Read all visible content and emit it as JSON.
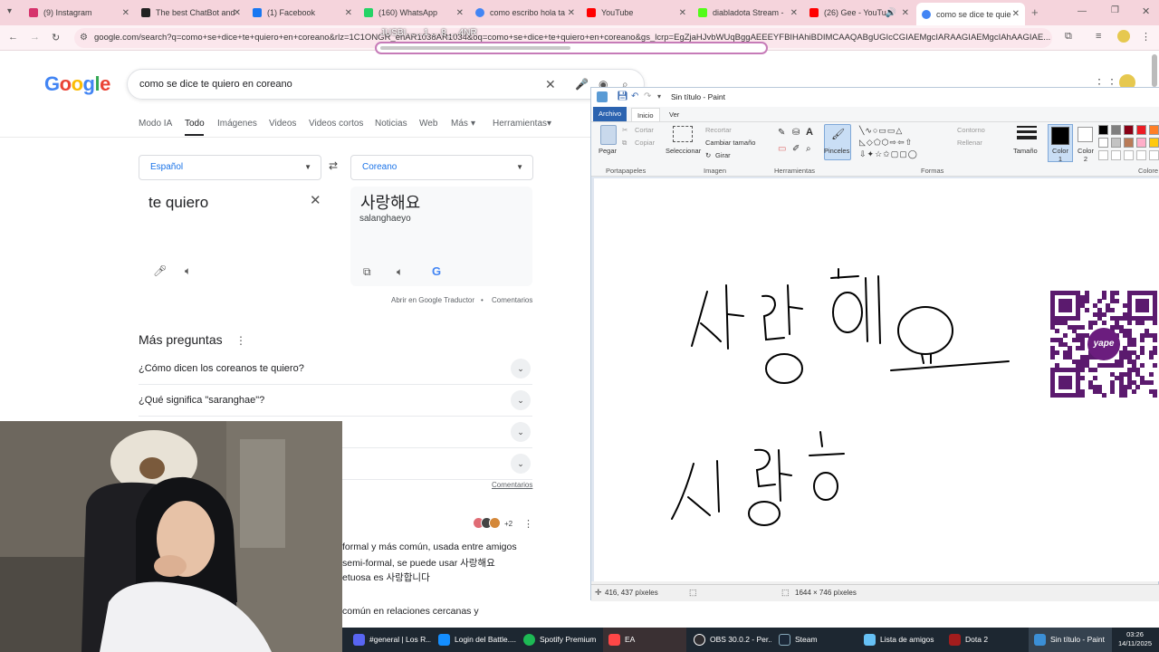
{
  "browser": {
    "tabs": [
      {
        "label": "(9) Instagram",
        "color": "#d6336c"
      },
      {
        "label": "The best ChatBot and",
        "color": "#222222"
      },
      {
        "label": "(1) Facebook",
        "color": "#1877f2"
      },
      {
        "label": "(160) WhatsApp",
        "color": "#25d366"
      },
      {
        "label": "como escribo hola ta",
        "color": "#4285f4"
      },
      {
        "label": "YouTube",
        "color": "#ff0000"
      },
      {
        "label": "diabladota Stream -",
        "color": "#53fc18"
      },
      {
        "label": "(26) Gee - YouTu",
        "color": "#ff0000"
      },
      {
        "label": "como se dice te quie",
        "color": "#4285f4"
      }
    ],
    "url": "google.com/search?q=como+se+dice+te+quiero+en+coreano&rlz=1C1ONGR_enAR1038AR1034&oq=como+se+dice+te+quiero+en+coreano&gs_lcrp=EgZjaHJvbWUqBggAEEEYFBIHAhiBDIMCAAQABgUGIcCGIAEMgcIARAAGIAEMgcIAhAAGIAE...",
    "url_overlay": "JUSBI.......1 ... 8_...4NR"
  },
  "google": {
    "logo": "Google",
    "query": "como se dice te quiero en coreano",
    "nav": [
      "Modo IA",
      "Todo",
      "Imágenes",
      "Videos",
      "Videos cortos",
      "Noticias",
      "Web",
      "Más",
      "Herramientas"
    ],
    "translator": {
      "source_lang": "Español",
      "target_lang": "Coreano",
      "input": "te quiero",
      "output": "사랑해요",
      "romanization": "salanghaeyo",
      "open_link": "Abrir en Google Traductor",
      "feedback": "Comentarios"
    },
    "mas_preguntas": "Más preguntas",
    "questions": [
      "¿Cómo dicen los coreanos te quiero?",
      "¿Qué significa \"saranghae\"?",
      "",
      ""
    ],
    "comentarios2": "Comentarios",
    "avatar_count": "+2",
    "body_lines": [
      "formal y más común, usada entre amigos",
      "semi-formal, se puede usar 사랑해요",
      "etuosa es 사랑합니다",
      "común en relaciones cercanas y"
    ]
  },
  "paint": {
    "title": "Sin título - Paint",
    "tabs": [
      "Archivo",
      "Inicio",
      "Ver"
    ],
    "ribbon": {
      "pegar": "Pegar",
      "cortar": "Cortar",
      "copiar": "Copiar",
      "seleccionar": "Seleccionar",
      "recortar": "Recortar",
      "cambiar_tamano": "Cambiar tamaño",
      "girar": "Girar",
      "pinceles": "Pinceles",
      "contorno": "Contorno",
      "rellenar": "Rellenar",
      "tamano": "Tamaño",
      "color1": "Color 1",
      "color2": "Color 2",
      "colores": "Colore"
    },
    "groups": [
      "Portapapeles",
      "Imagen",
      "Herramientas",
      "Formas"
    ],
    "palette": [
      "#000000",
      "#7f7f7f",
      "#880015",
      "#ed1c24",
      "#ff7f27",
      "#ffffff",
      "#c3c3c3",
      "#b97a57",
      "#ffaec9",
      "#ffc90e"
    ],
    "status": {
      "coords": "416, 437 píxeles",
      "size": "1644 × 746 píxeles"
    },
    "qr_label": "yape"
  },
  "taskbar": {
    "items": [
      {
        "label": "#general | Los R...",
        "color": "#5865f2"
      },
      {
        "label": "Login del Battle....",
        "color": "#148eff"
      },
      {
        "label": "Spotify Premium",
        "color": "#1db954"
      },
      {
        "label": "EA",
        "color": "#ff4747"
      },
      {
        "label": "OBS 30.0.2 - Per...",
        "color": "#302e31"
      },
      {
        "label": "Steam",
        "color": "#1b2838"
      },
      {
        "label": "Lista de amigos",
        "color": "#66c0f4"
      },
      {
        "label": "Dota 2",
        "color": "#a31d1d"
      },
      {
        "label": "Sin título - Paint",
        "color": "#3b8fd6"
      }
    ],
    "time": "03:26",
    "date": "14/11/2025"
  }
}
